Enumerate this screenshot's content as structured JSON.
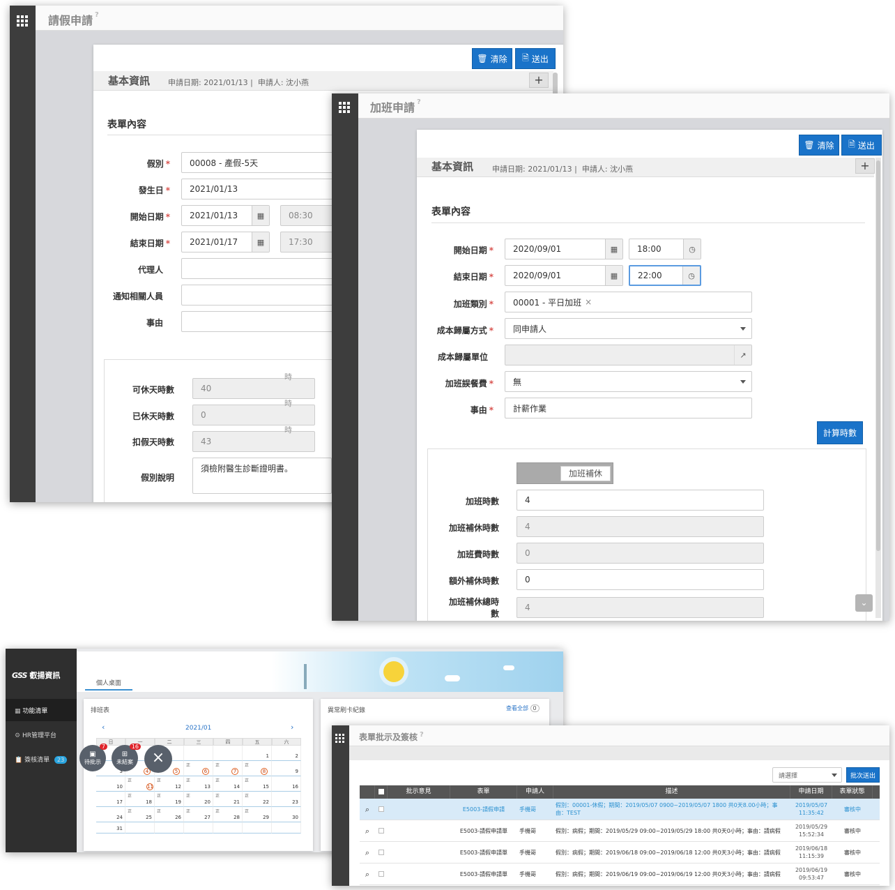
{
  "leave_window": {
    "title": "請假申請",
    "help": "?",
    "btn_clear": "清除",
    "btn_submit": "送出",
    "section_title": "基本資訊",
    "apply_date_label": "申請日期: 2021/01/13",
    "sep": "|",
    "applicant_label": "申請人: 沈小燕",
    "plus": "+",
    "form_title": "表單內容",
    "fields": {
      "leave_type": {
        "label": "假別",
        "value": "00008 - 產假-5天"
      },
      "occur_date": {
        "label": "發生日",
        "value": "2021/01/13"
      },
      "start_date": {
        "label": "開始日期",
        "value": "2021/01/13",
        "time": "08:30"
      },
      "end_date": {
        "label": "結束日期",
        "value": "2021/01/17",
        "time": "17:30"
      },
      "agent": {
        "label": "代理人",
        "value": ""
      },
      "notify": {
        "label": "通知相關人員",
        "value": ""
      },
      "reason": {
        "label": "事由",
        "value": ""
      }
    },
    "stats": {
      "available": {
        "label": "可休天時數",
        "value": "40",
        "unit": "時"
      },
      "used": {
        "label": "已休天時數",
        "value": "0",
        "unit": "時"
      },
      "deduct": {
        "label": "扣假天時數",
        "value": "43",
        "unit": "時"
      },
      "note": {
        "label": "假別說明",
        "value": "須檢附醫生診斷證明書。"
      }
    }
  },
  "overtime_window": {
    "title": "加班申請",
    "help": "?",
    "btn_clear": "清除",
    "btn_submit": "送出",
    "section_title": "基本資訊",
    "apply_date_label": "申請日期: 2021/01/13",
    "sep": "|",
    "applicant_label": "申請人: 沈小燕",
    "plus": "+",
    "form_title": "表單內容",
    "fields": {
      "start": {
        "label": "開始日期",
        "date": "2020/09/01",
        "time": "18:00"
      },
      "end": {
        "label": "結束日期",
        "date": "2020/09/01",
        "time": "22:00"
      },
      "category": {
        "label": "加班類別",
        "value": "00001 - 平日加班",
        "remove": "×"
      },
      "cost_method": {
        "label": "成本歸屬方式",
        "value": "同申請人"
      },
      "cost_unit": {
        "label": "成本歸屬單位",
        "value": ""
      },
      "meal": {
        "label": "加班誤餐費",
        "value": "無"
      },
      "reason": {
        "label": "事由",
        "value": "計薪作業"
      }
    },
    "calc_button": "計算時數",
    "toggle_label": "加班補休",
    "results": {
      "ot_hours": {
        "label": "加班時數",
        "value": "4"
      },
      "comp_hours": {
        "label": "加班補休時數",
        "value": "4"
      },
      "pay_hours": {
        "label": "加班費時數",
        "value": "0"
      },
      "extra_comp": {
        "label": "額外補休時數",
        "value": "0"
      },
      "total_comp_a": "加班補休總時",
      "total_comp_b": "數",
      "total_comp_value": "4"
    }
  },
  "portal_window": {
    "logo_mark": "GSS",
    "logo_text": "叡揚資訊",
    "menu": [
      {
        "label": "功能清單"
      },
      {
        "label": "HR管理平台"
      },
      {
        "label": "簽核清單",
        "badge": "23"
      }
    ],
    "tab": "個人桌面",
    "schedule_title": "排班表",
    "month": "2021/01",
    "weekdays": [
      "日",
      "一",
      "二",
      "三",
      "四",
      "五",
      "六"
    ],
    "weeks": [
      [
        "",
        "",
        "",
        "",
        "",
        "1",
        "2"
      ],
      [
        "3",
        "4",
        "5",
        "6",
        "7",
        "8",
        "9"
      ],
      [
        "10",
        "11",
        "12",
        "13",
        "14",
        "15",
        "16"
      ],
      [
        "17",
        "18",
        "19",
        "20",
        "21",
        "22",
        "23"
      ],
      [
        "24",
        "25",
        "26",
        "27",
        "28",
        "29",
        "30"
      ],
      [
        "31",
        "",
        "",
        "",
        "",
        "",
        ""
      ]
    ],
    "zheng": "正",
    "abnormal_title": "異常刷卡紀錄",
    "view_all": "查看全部",
    "view_all_count": "0",
    "fab": [
      {
        "label": "待批示",
        "badge": "7"
      },
      {
        "label": "未結案",
        "badge": "16"
      }
    ],
    "fab_close": "×"
  },
  "approval_window": {
    "title": "表單批示及簽核",
    "help": "?",
    "select_placeholder": "請選擇",
    "batch_button": "批次送出",
    "columns": [
      "",
      "",
      "批示意見",
      "表單",
      "申請人",
      "描述",
      "申請日期",
      "表單狀態"
    ],
    "rows": [
      {
        "form": "E5003-請假申請",
        "applicant": "手機哥",
        "desc": "假別：00001-休假；期間：2019/05/07 0900~2019/05/07 1800 共0天8.00小時；事由：TEST",
        "date": "2019/05/07",
        "time": "11:35:42",
        "status": "審核中",
        "highlight": true
      },
      {
        "form": "E5003-請假申請單",
        "applicant": "手機哥",
        "desc": "假別：病假；期間：2019/05/29 09:00~2019/05/29 18:00 共0天0小時；事由：請病假",
        "date": "2019/05/29",
        "time": "15:52:34",
        "status": "審核中",
        "highlight": false
      },
      {
        "form": "E5003-請假申請單",
        "applicant": "手機哥",
        "desc": "假別：病假；期間：2019/06/18 09:00~2019/06/18 12:00 共0天3小時；事由：請病假",
        "date": "2019/06/18",
        "time": "11:15:39",
        "status": "審核中",
        "highlight": false
      },
      {
        "form": "E5003-請假申請單",
        "applicant": "手機哥",
        "desc": "假別：病假；期間：2019/06/19 09:00~2019/06/19 12:00 共0天3小時；事由：請病假",
        "date": "2019/06/19",
        "time": "09:53:47",
        "status": "審核中",
        "highlight": false
      }
    ]
  }
}
